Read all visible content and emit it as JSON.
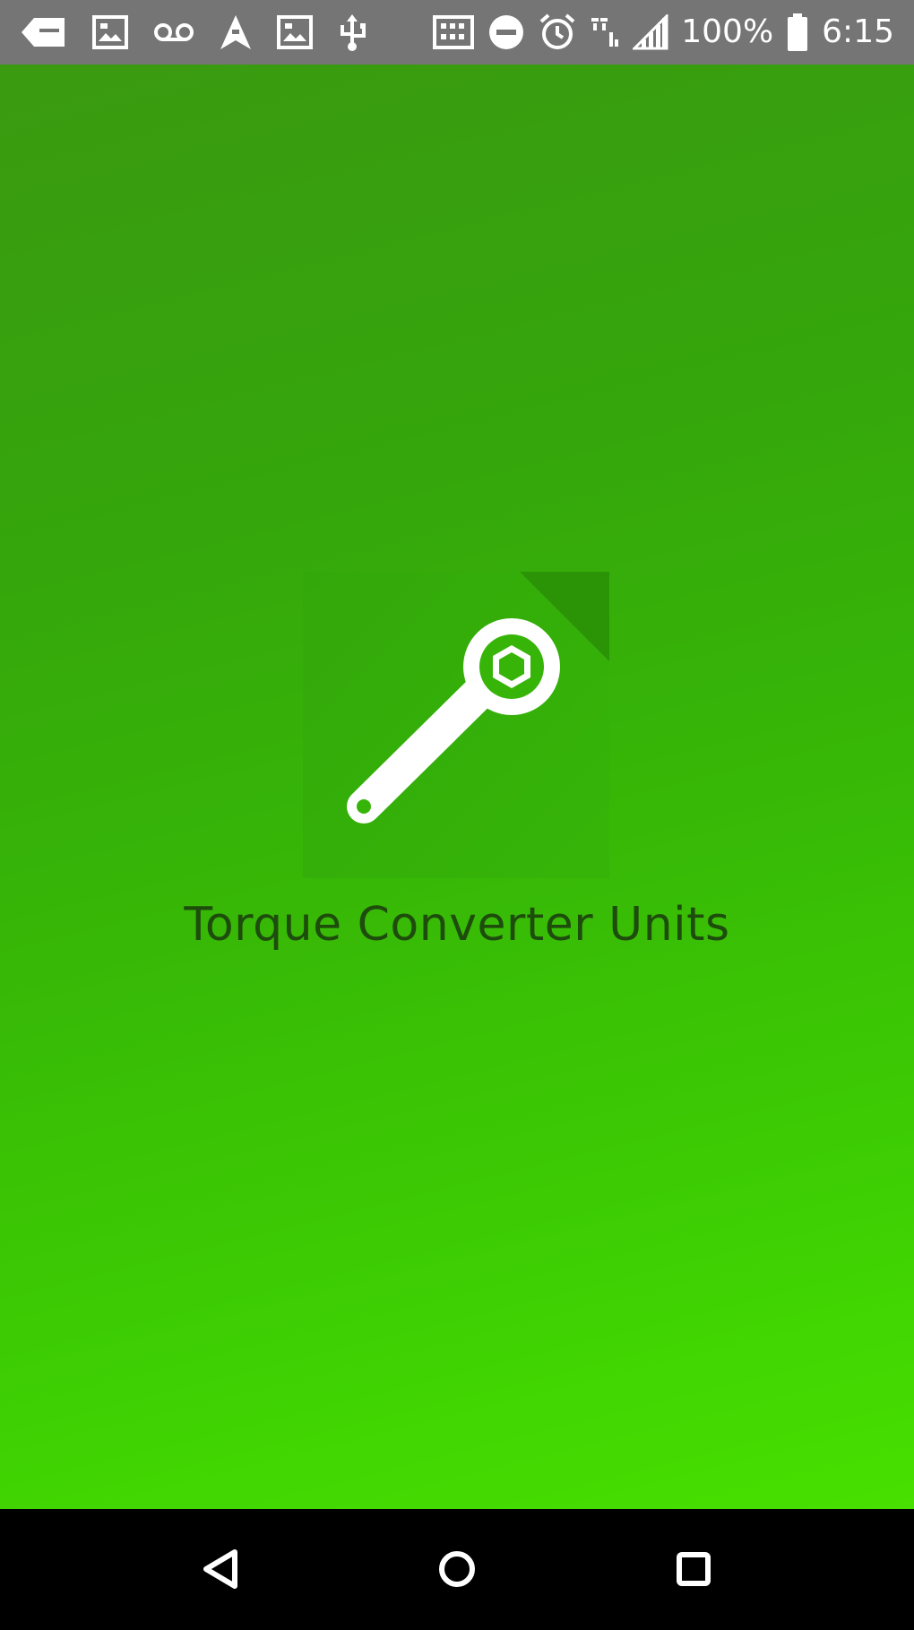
{
  "status_bar": {
    "battery_percent": "100%",
    "time": "6:15",
    "icons": [
      "notification-tag-icon",
      "photo-icon",
      "voicemail-icon",
      "navigation-icon",
      "photo-icon",
      "usb-icon",
      "cast-icon",
      "do-not-disturb-icon",
      "alarm-icon",
      "wifi-icon",
      "signal-icon",
      "battery-icon"
    ]
  },
  "splash": {
    "app_name": "Torque Converter Units",
    "logo_icon": "wrench-icon",
    "background_colors": [
      "#3a9a10",
      "#47e000"
    ],
    "text_color": "#1e4c0c"
  },
  "nav_bar": {
    "buttons": [
      "back-icon",
      "home-icon",
      "recents-icon"
    ]
  }
}
